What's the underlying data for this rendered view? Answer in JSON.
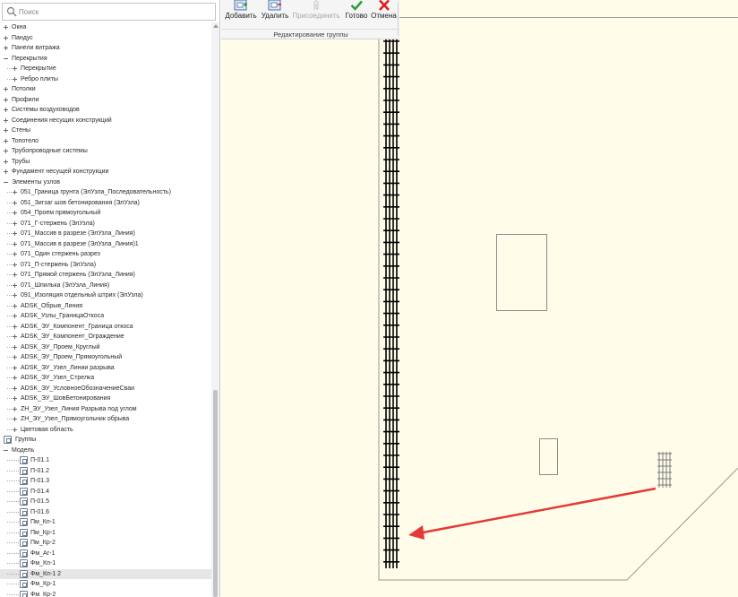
{
  "search": {
    "placeholder": "Поиск"
  },
  "tree": {
    "items": [
      {
        "label": "Окна",
        "expander": "plus",
        "level": 0
      },
      {
        "label": "Пандус",
        "expander": "plus",
        "level": 0
      },
      {
        "label": "Панели витража",
        "expander": "plus",
        "level": 0
      },
      {
        "label": "Перекрытия",
        "expander": "minus",
        "level": 0
      },
      {
        "label": "Перекрытие",
        "expander": "plus",
        "level": 1
      },
      {
        "label": "Ребро плиты",
        "expander": "plus",
        "level": 1
      },
      {
        "label": "Потолки",
        "expander": "plus",
        "level": 0
      },
      {
        "label": "Профили",
        "expander": "plus",
        "level": 0
      },
      {
        "label": "Системы воздуховодов",
        "expander": "plus",
        "level": 0
      },
      {
        "label": "Соединения несущих конструкций",
        "expander": "plus",
        "level": 0
      },
      {
        "label": "Стены",
        "expander": "plus",
        "level": 0
      },
      {
        "label": "Топотело",
        "expander": "plus",
        "level": 0
      },
      {
        "label": "Трубопроводные системы",
        "expander": "plus",
        "level": 0
      },
      {
        "label": "Трубы",
        "expander": "plus",
        "level": 0
      },
      {
        "label": "Фундамент несущей конструкции",
        "expander": "plus",
        "level": 0
      },
      {
        "label": "Элементы узлов",
        "expander": "minus",
        "level": 0
      },
      {
        "label": "051_Граница грунта (ЭлУзла_Последовательность)",
        "expander": "plus",
        "level": 1
      },
      {
        "label": "051_Зигзаг шов бетонирования (ЭлУзла)",
        "expander": "plus",
        "level": 1
      },
      {
        "label": "054_Проем прямоугольный",
        "expander": "plus",
        "level": 1
      },
      {
        "label": "071_Г-стержень (ЭлУзла)",
        "expander": "plus",
        "level": 1
      },
      {
        "label": "071_Массив в разрезе (ЭлУзла_Линия)",
        "expander": "plus",
        "level": 1
      },
      {
        "label": "071_Массив в разрезе (ЭлУзла_Линия)1",
        "expander": "plus",
        "level": 1
      },
      {
        "label": "071_Один стержень разрез",
        "expander": "plus",
        "level": 1
      },
      {
        "label": "071_П-стержень (ЭлУзла)",
        "expander": "plus",
        "level": 1
      },
      {
        "label": "071_Прямой стержень (ЭлУзла_Линия)",
        "expander": "plus",
        "level": 1
      },
      {
        "label": "071_Шпилька (ЭлУзла_Линия)",
        "expander": "plus",
        "level": 1
      },
      {
        "label": "091_Изоляция отдельный штрих (ЭлУзла)",
        "expander": "plus",
        "level": 1
      },
      {
        "label": "ADSK_Обрыв_Линия",
        "expander": "plus",
        "level": 1
      },
      {
        "label": "ADSK_Узлы_ГраницаОткоса",
        "expander": "plus",
        "level": 1
      },
      {
        "label": "ADSK_ЭУ_Компонент_Граница откоса",
        "expander": "plus",
        "level": 1
      },
      {
        "label": "ADSK_ЭУ_Компонент_Ограждение",
        "expander": "plus",
        "level": 1
      },
      {
        "label": "ADSK_ЭУ_Проем_Круглый",
        "expander": "plus",
        "level": 1
      },
      {
        "label": "ADSK_ЭУ_Проем_Прямоугольный",
        "expander": "plus",
        "level": 1
      },
      {
        "label": "ADSK_ЭУ_Узел_Линии разрыва",
        "expander": "plus",
        "level": 1
      },
      {
        "label": "ADSK_ЭУ_Узел_Стрелка",
        "expander": "plus",
        "level": 1
      },
      {
        "label": "ADSK_ЭУ_УсловноеОбозначениеСваи",
        "expander": "plus",
        "level": 1
      },
      {
        "label": "ADSK_ЭУ_ШовБетонирования",
        "expander": "plus",
        "level": 1
      },
      {
        "label": "ZH_ЭУ_Узел_Линия Разрыва под углом",
        "expander": "plus",
        "level": 1
      },
      {
        "label": "ZH_ЭУ_Узел_Прямоугольник обрыва",
        "expander": "plus",
        "level": 1
      },
      {
        "label": "Цветовая область",
        "expander": "plus",
        "level": 1
      },
      {
        "label": "Группы",
        "expander": "group",
        "level": 0
      },
      {
        "label": "Модель",
        "expander": "minus",
        "level": 0
      },
      {
        "label": "П-01.1",
        "expander": "group",
        "level": 1
      },
      {
        "label": "П-01.2",
        "expander": "group",
        "level": 1
      },
      {
        "label": "П-01.3",
        "expander": "group",
        "level": 1
      },
      {
        "label": "П-01.4",
        "expander": "group",
        "level": 1
      },
      {
        "label": "П-01.5",
        "expander": "group",
        "level": 1
      },
      {
        "label": "П-01.6",
        "expander": "group",
        "level": 1
      },
      {
        "label": "Пм_Кп-1",
        "expander": "group",
        "level": 1
      },
      {
        "label": "Пм_Кр-1",
        "expander": "group",
        "level": 1
      },
      {
        "label": "Пм_Кр-2",
        "expander": "group",
        "level": 1
      },
      {
        "label": "Фм_Аг-1",
        "expander": "group",
        "level": 1
      },
      {
        "label": "Фм_Кп-1",
        "expander": "group",
        "level": 1
      },
      {
        "label": "Фм_Кп-1 2",
        "expander": "group",
        "level": 1,
        "selected": true
      },
      {
        "label": "Фм_Кр-1",
        "expander": "group",
        "level": 1
      },
      {
        "label": "Фм_Кр-2",
        "expander": "group",
        "level": 1
      }
    ]
  },
  "ribbon": {
    "add_label": "Добавить",
    "remove_label": "Удалить",
    "attach_label": "Присоединить",
    "done_label": "Готово",
    "cancel_label": "Отмена",
    "group_label": "Редактирование группы"
  },
  "colors": {
    "canvas_background": "#fffcea",
    "annotation_arrow": "#e53935",
    "done_check": "#2e9e3e",
    "cancel_x": "#e21d1d"
  },
  "icons": {
    "search": "search-icon",
    "add": "add-to-group-icon",
    "remove": "remove-from-group-icon",
    "attach": "attach-icon",
    "done": "checkmark-icon",
    "cancel": "close-x-icon"
  }
}
